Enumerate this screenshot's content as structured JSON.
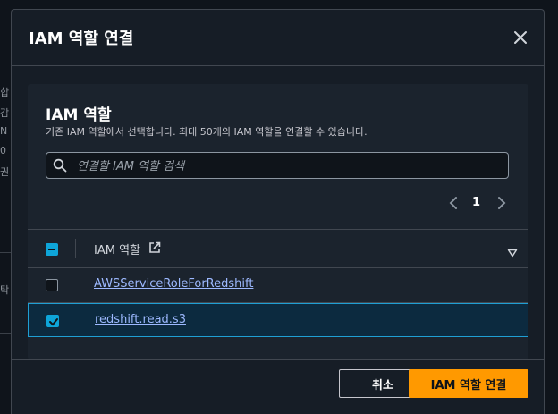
{
  "background": {
    "fragments": [
      "합",
      "감",
      "N",
      "0",
      "권",
      "탁"
    ]
  },
  "modal": {
    "title": "IAM 역할 연결",
    "close_icon": "close-icon"
  },
  "container": {
    "title": "IAM 역할",
    "description": "기존 IAM 역할에서 선택합니다. 최대 50개의 IAM 역할을 연결할 수 있습니다.",
    "search": {
      "placeholder": "연결할 IAM 역할 검색",
      "value": ""
    },
    "pagination": {
      "current_page": "1"
    },
    "table": {
      "header_label": "IAM 역할",
      "rows": [
        {
          "name": "AWSServiceRoleForRedshift",
          "checked": false
        },
        {
          "name": "redshift.read.s3",
          "checked": true
        }
      ]
    }
  },
  "footer": {
    "cancel_label": "취소",
    "confirm_label": "IAM 역할 연결"
  },
  "colors": {
    "accent": "#ff9900",
    "link": "#9db9ff",
    "selection": "#0ea5d9"
  }
}
